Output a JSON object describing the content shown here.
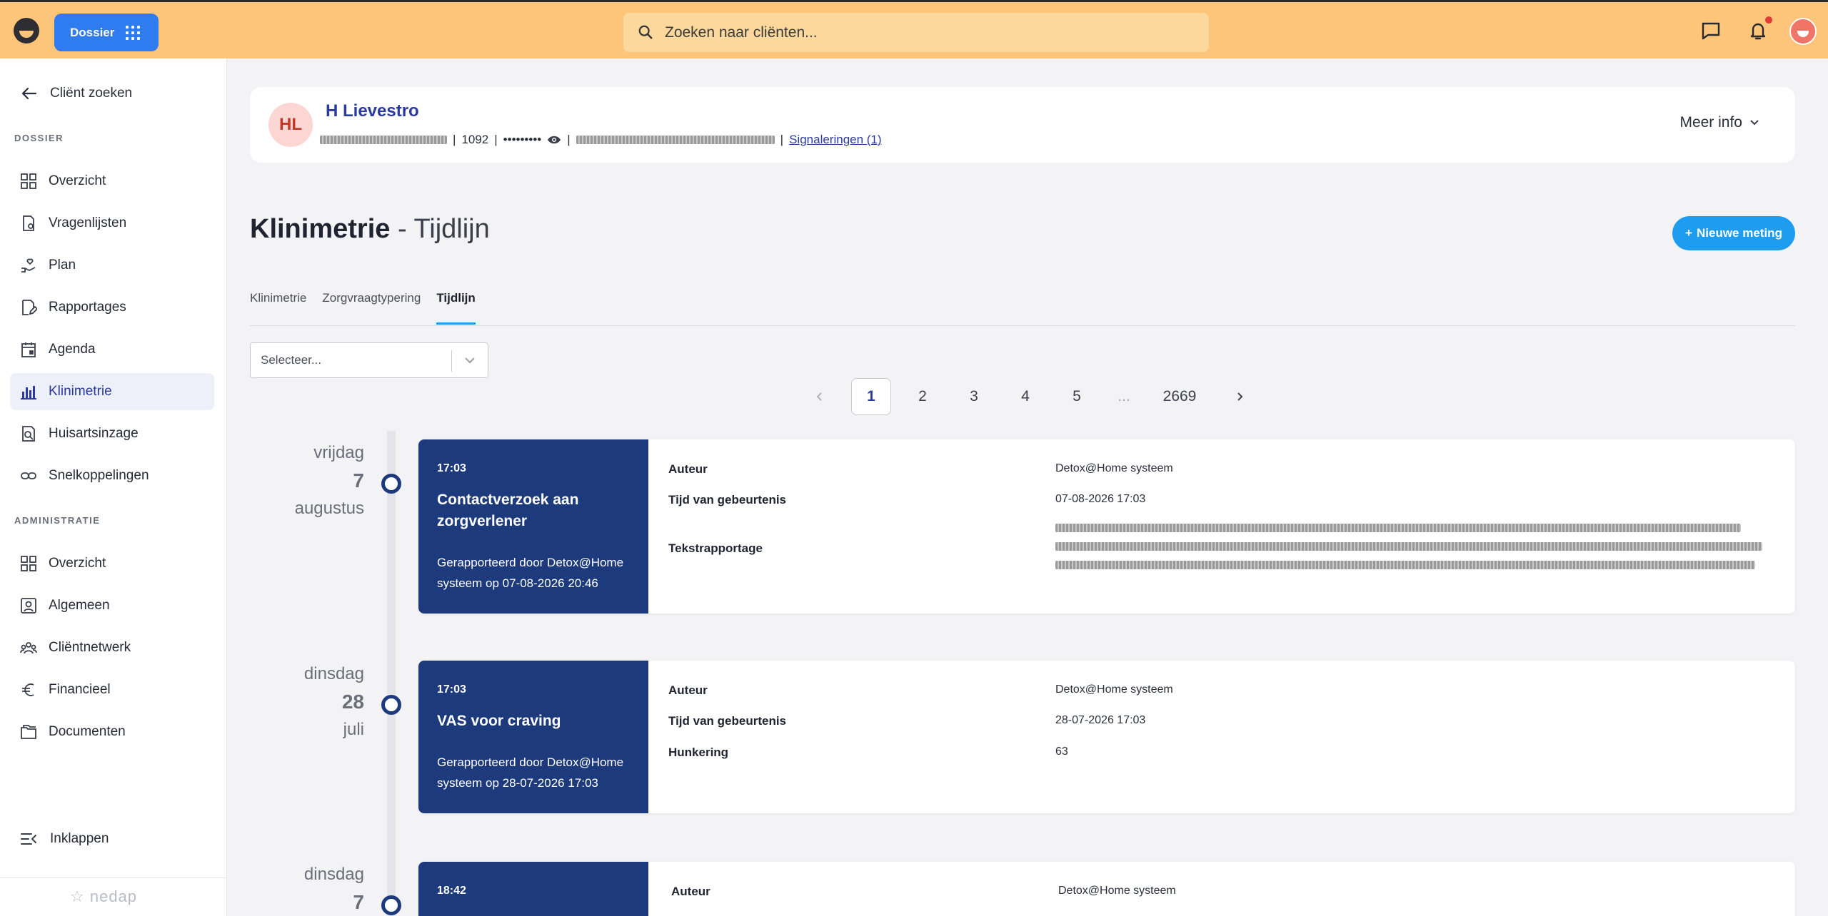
{
  "topbar": {
    "dossier_label": "Dossier",
    "search_placeholder": "Zoeken naar cliënten...",
    "accent_color": "#fcc57a",
    "icons": [
      "chat-icon",
      "bell-icon",
      "user-avatar"
    ]
  },
  "sidebar": {
    "back_label": "Cliënt zoeken",
    "section_dossier": "DOSSIER",
    "dossier_items": [
      {
        "label": "Overzicht",
        "icon": "grid-icon"
      },
      {
        "label": "Vragenlijsten",
        "icon": "questionnaire-icon"
      },
      {
        "label": "Plan",
        "icon": "hand-heart-icon"
      },
      {
        "label": "Rapportages",
        "icon": "report-icon"
      },
      {
        "label": "Agenda",
        "icon": "calendar-icon"
      },
      {
        "label": "Klinimetrie",
        "icon": "chart-icon",
        "active": true
      },
      {
        "label": "Huisartsinzage",
        "icon": "doctor-doc-icon"
      },
      {
        "label": "Snelkoppelingen",
        "icon": "link-icon"
      }
    ],
    "section_admin": "ADMINISTRATIE",
    "admin_items": [
      {
        "label": "Overzicht",
        "icon": "grid-icon"
      },
      {
        "label": "Algemeen",
        "icon": "person-card-icon"
      },
      {
        "label": "Cliëntnetwerk",
        "icon": "network-icon"
      },
      {
        "label": "Financieel",
        "icon": "euro-icon"
      },
      {
        "label": "Documenten",
        "icon": "folder-icon"
      }
    ],
    "collapse_label": "Inklappen",
    "brand": "nedap"
  },
  "client": {
    "initials": "HL",
    "name": "H Lievestro",
    "postcode": "1092",
    "bsn_masked": "•••••••••",
    "signaleringen": "Signaleringen (1)",
    "meer_info": "Meer info"
  },
  "page": {
    "title_bold": "Klinimetrie",
    "title_rest": " - Tijdlijn",
    "new_button": "Nieuwe meting",
    "tabs": [
      {
        "label": "Klinimetrie",
        "active": false
      },
      {
        "label": "Zorgvraagtypering",
        "active": false
      },
      {
        "label": "Tijdlijn",
        "active": true
      }
    ],
    "select_placeholder": "Selecteer...",
    "pagination": {
      "pages": [
        "1",
        "2",
        "3",
        "4",
        "5",
        "...",
        "2669"
      ],
      "current": "1"
    }
  },
  "timeline": [
    {
      "weekday": "vrijdag",
      "day": "7",
      "month": "augustus",
      "time": "17:03",
      "title": "Contactverzoek aan zorgverlener",
      "reported": "Gerapporteerd door Detox@Home systeem op 07-08-2026 20:46",
      "fields": [
        {
          "key": "Auteur",
          "value": "Detox@Home systeem"
        },
        {
          "key": "Tijd van gebeurtenis",
          "value": "07-08-2026 17:03"
        },
        {
          "key": "Tekstrapportage",
          "value": ""
        }
      ]
    },
    {
      "weekday": "dinsdag",
      "day": "28",
      "month": "juli",
      "time": "17:03",
      "title": "VAS voor craving",
      "reported": "Gerapporteerd door Detox@Home systeem op 28-07-2026 17:03",
      "fields": [
        {
          "key": "Auteur",
          "value": "Detox@Home systeem"
        },
        {
          "key": "Tijd van gebeurtenis",
          "value": "28-07-2026 17:03"
        },
        {
          "key": "Hunkering",
          "value": "63"
        }
      ]
    },
    {
      "weekday": "dinsdag",
      "day": "7",
      "month": "",
      "time": "18:42",
      "title": "",
      "reported": "",
      "fields": [
        {
          "key": "Auteur",
          "value": "Detox@Home systeem"
        }
      ]
    }
  ]
}
